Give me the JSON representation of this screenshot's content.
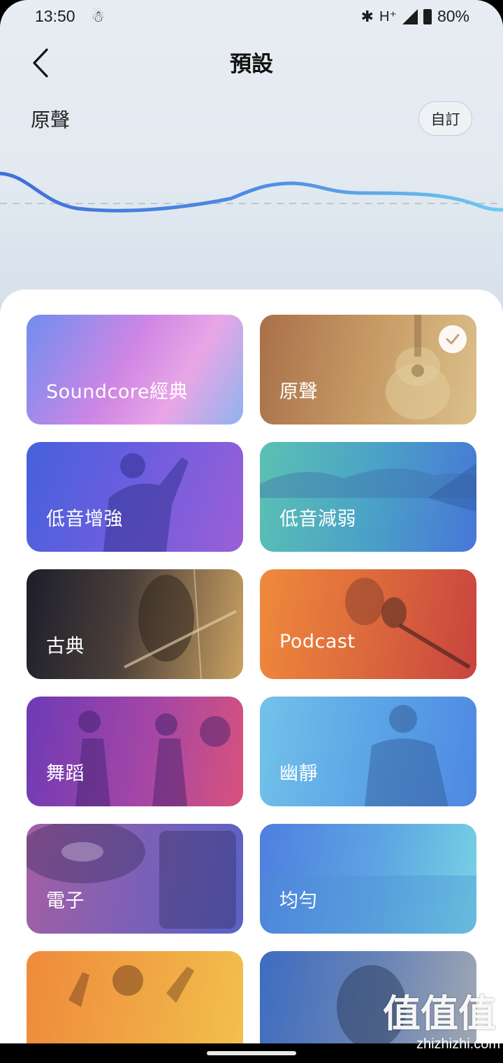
{
  "status_bar": {
    "time": "13:50",
    "network": "H⁺",
    "battery": "80%"
  },
  "header": {
    "title": "預設",
    "back_icon": "chevron-left-icon"
  },
  "current_preset": {
    "name": "原聲",
    "custom_label": "自訂"
  },
  "colors": {
    "curve_start": "#3f6fd9",
    "curve_end": "#66c4ee",
    "sheet": "#ffffff"
  },
  "presets": [
    {
      "label": "Soundcore經典",
      "selected": false,
      "gradient": [
        "#6f8ef0",
        "#e79be6"
      ]
    },
    {
      "label": "原聲",
      "selected": true,
      "gradient": [
        "#a9704a",
        "#dcc08a"
      ]
    },
    {
      "label": "低音增強",
      "selected": false,
      "gradient": [
        "#4c63df",
        "#9b5fd6"
      ]
    },
    {
      "label": "低音減弱",
      "selected": false,
      "gradient": [
        "#5cc1b3",
        "#4876d8"
      ]
    },
    {
      "label": "古典",
      "selected": false,
      "gradient": [
        "#1c1e2b",
        "#caa161"
      ]
    },
    {
      "label": "Podcast",
      "selected": false,
      "gradient": [
        "#f08a3c",
        "#c8433f"
      ]
    },
    {
      "label": "舞蹈",
      "selected": false,
      "gradient": [
        "#6d3ab5",
        "#d8527c"
      ]
    },
    {
      "label": "幽靜",
      "selected": false,
      "gradient": [
        "#67b8e6",
        "#4e88e2"
      ]
    },
    {
      "label": "電子",
      "selected": false,
      "gradient": [
        "#a35fa3",
        "#5962c6"
      ]
    },
    {
      "label": "均勻",
      "selected": false,
      "gradient": [
        "#4f7ee0",
        "#78d3e4"
      ]
    },
    {
      "label": "",
      "selected": false,
      "gradient": [
        "#ef8a3c",
        "#f2c04e"
      ]
    },
    {
      "label": "",
      "selected": false,
      "gradient": [
        "#3d6cc1",
        "#a2a9b3"
      ]
    }
  ],
  "watermark": {
    "main": "值值值",
    "sub": "zhizhizhi.com"
  }
}
